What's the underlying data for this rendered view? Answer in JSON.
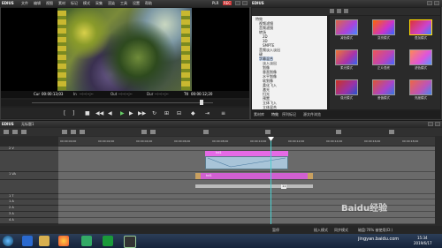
{
  "player": {
    "logo": "EDIUS",
    "menu": [
      "文件",
      "编辑",
      "视图",
      "素材",
      "标记",
      "模式",
      "采集",
      "渲染",
      "工具",
      "设置",
      "帮助"
    ],
    "mode_badge": "PLR",
    "mode_badge2": "REC",
    "timecode": {
      "cur_label": "Cur",
      "cur_value": "00:00:13;03",
      "in_label": "In",
      "in_value": "--:--:--;--",
      "out_label": "Out",
      "out_value": "--:--:--;--",
      "dur_label": "Dur",
      "dur_value": "--:--:--;--",
      "ttl_label": "Ttl",
      "ttl_value": "00:00:12;20"
    }
  },
  "library": {
    "logo": "EDIUS",
    "tree": [
      "特效",
      "视频滤镜",
      "音频滤镜",
      "转场",
      "2D",
      "3D",
      "SMPTE",
      "音频淡入淡出",
      "键",
      "字幕混合",
      "淡入淡出",
      "划像",
      "垂直划像",
      "水平划像",
      "软划像",
      "柔化飞入",
      "激光",
      "扫光",
      "预置",
      "立体飞入",
      "立体混合"
    ],
    "effects": [
      "减色模式",
      "变亮模式",
      "叠加模式",
      "柔光模式",
      "正片叠底",
      "滤色模式",
      "强光模式",
      "差值模式",
      "亮度模式"
    ],
    "tabs": [
      "素材库",
      "特效",
      "序列标记",
      "源文件浏览"
    ]
  },
  "timeline": {
    "logo": "EDIUS",
    "sequence_name": "无标题1",
    "ruler_ticks": [
      "00:00:00;00",
      "00:00:02;00",
      "00:00:04;00",
      "00:00:06;00",
      "00:00:08;00",
      "00:00:10;00",
      "00:00:12;00",
      "00:00:14;00",
      "00:00:16;00",
      "00:00:18;00"
    ],
    "tracks": [
      "2 V",
      "",
      "1 VA",
      "",
      "1 T",
      "1 A",
      "2 A",
      "3 A",
      "4 A"
    ],
    "clip_label_v": "hd1",
    "clip_label_a": "hd1",
    "playhead_tag": "11"
  },
  "status": {
    "text1": "暂停",
    "text2": "插入模式",
    "text3": "同步模式",
    "text4": "磁盘:76% 被使用(D:)"
  },
  "taskbar": {
    "time": "15:34",
    "date": "2019/6/17",
    "watermark": "Baidu经验",
    "watermark_url": "jingyan.baidu.com"
  },
  "colors": {
    "clip_pink": "#e66ae6",
    "clip_mix": "#a8c4d8",
    "playhead": "#4ad0d0",
    "taskbar": "#1e2f4a"
  }
}
